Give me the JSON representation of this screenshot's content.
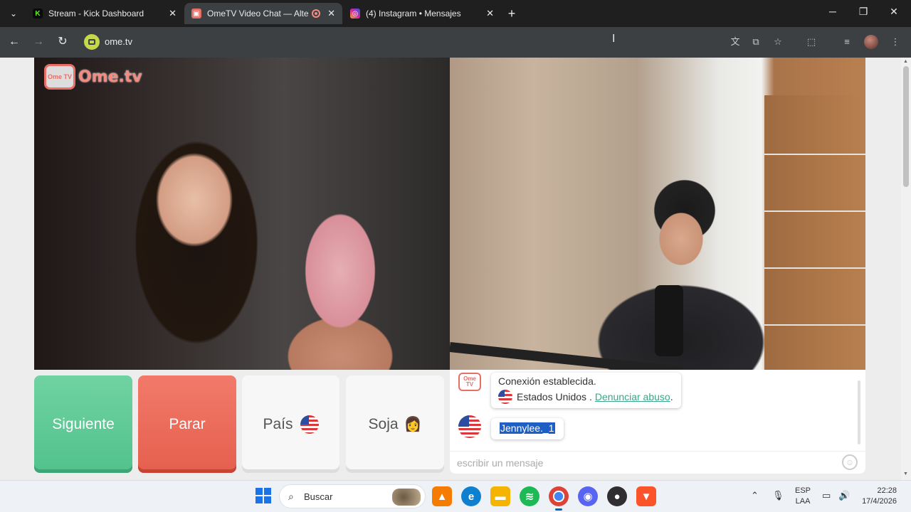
{
  "browser": {
    "tabs": [
      {
        "title": "Stream - Kick Dashboard",
        "favicon": "K",
        "favicon_color": "#53fc18"
      },
      {
        "title": "OmeTV Video Chat — Alter",
        "favicon": "▣",
        "favicon_color": "#e76f66",
        "recording": true
      },
      {
        "title": "(4) Instagram • Mensajes",
        "favicon": "◎",
        "favicon_color": "#d6249f"
      }
    ],
    "new_tab": "+",
    "url": "ome.tv"
  },
  "page": {
    "logo_tv": "Ome TV",
    "logo_text": "Ome.tv",
    "buttons": {
      "next": "Siguiente",
      "stop": "Parar",
      "country": "País",
      "gender": "Soja",
      "gender_emoji": "👩"
    },
    "chat": {
      "avatar_tv": "Ome TV",
      "system_line1": "Conexión establecida.",
      "system_country": "Estados Unidos .",
      "report_link": "Denunciar abuso",
      "report_suffix": ".",
      "message": "Jennylee._1",
      "input_placeholder": "escribir un mensaje"
    }
  },
  "taskbar": {
    "search_label": "Buscar",
    "lang_line1": "ESP",
    "lang_line2": "LAA",
    "time": "22:28",
    "date": "17/4/2026"
  },
  "colors": {
    "next_button": "#52c28d",
    "stop_button": "#e55f4e",
    "brand": "#e76f66",
    "link": "#3aa788"
  }
}
